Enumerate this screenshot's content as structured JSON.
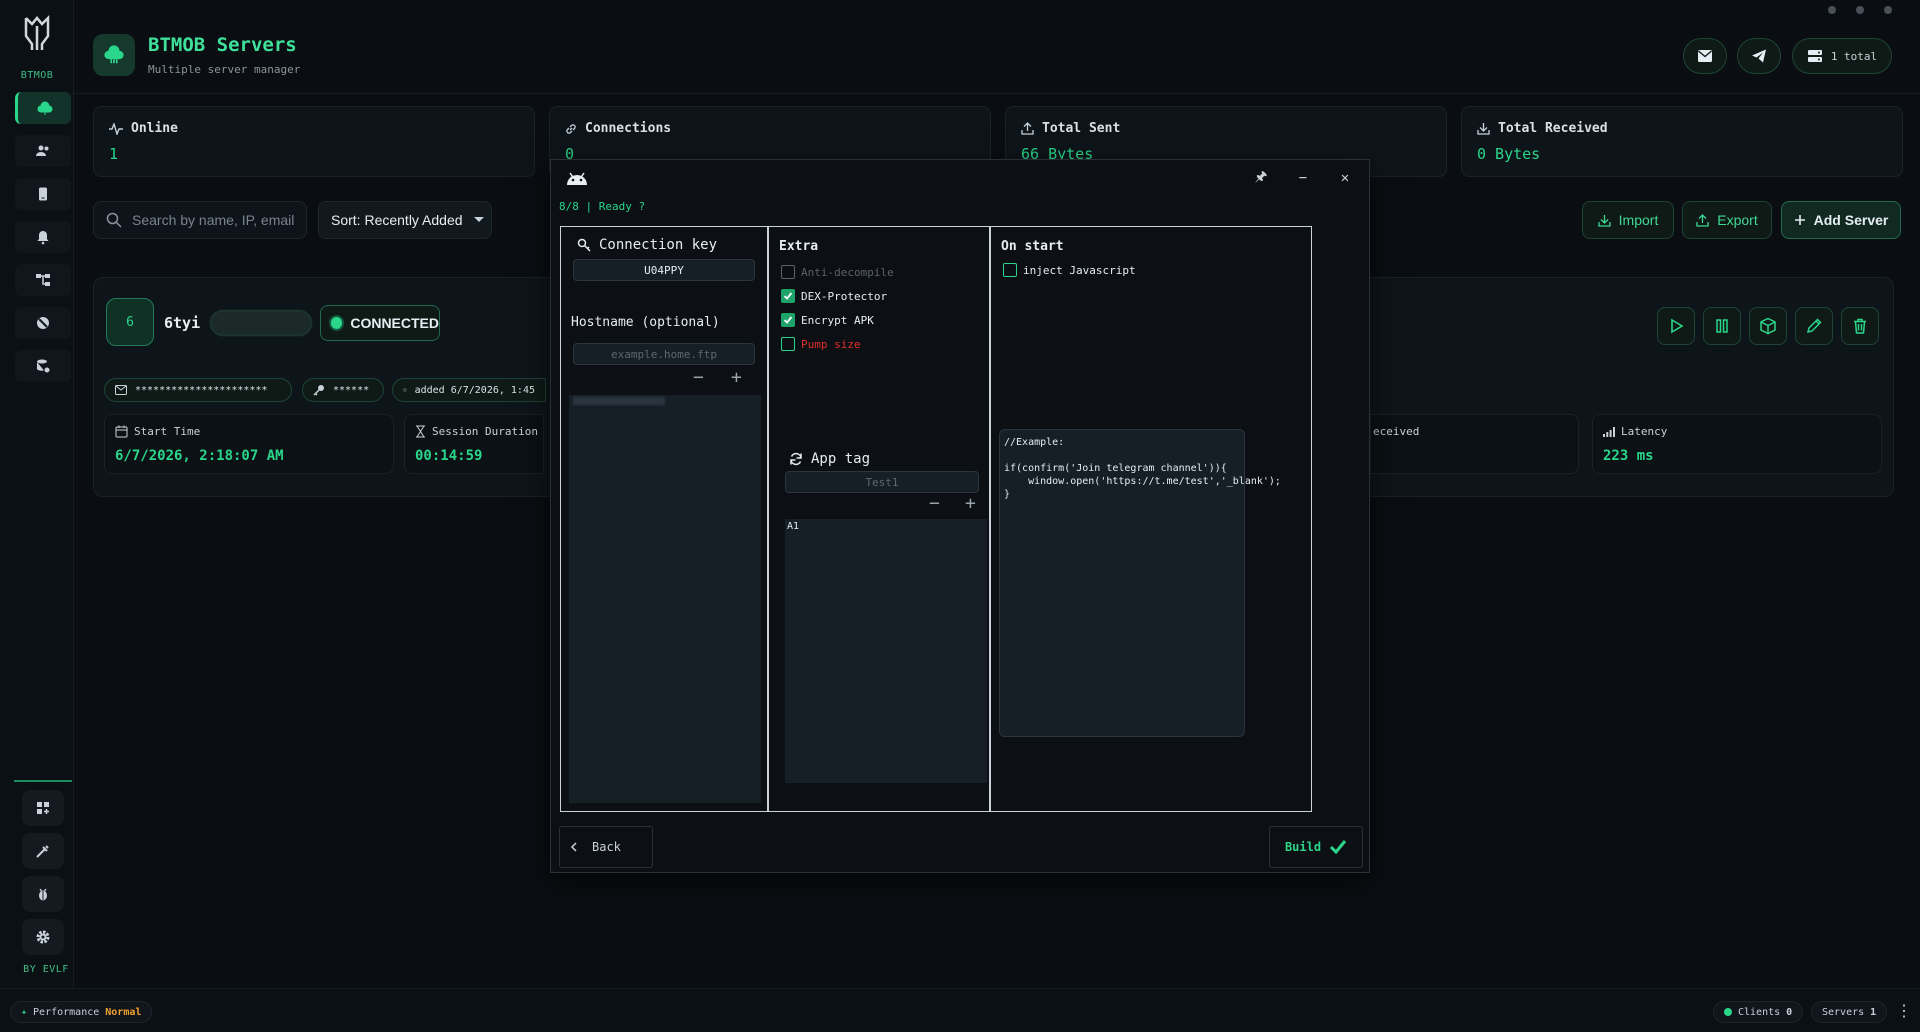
{
  "sidebar": {
    "brand": "BTMOB",
    "footer": "BY EVLF"
  },
  "header": {
    "title": "BTMOB Servers",
    "subtitle": "Multiple server manager",
    "total_label": "1 total"
  },
  "stats": [
    {
      "label": "Online",
      "value": "1"
    },
    {
      "label": "Connections",
      "value": "0"
    },
    {
      "label": "Total Sent",
      "value": "66 Bytes"
    },
    {
      "label": "Total Received",
      "value": "0 Bytes"
    }
  ],
  "toolbar": {
    "search_placeholder": "Search by name, IP, email",
    "sort_label": "Sort: Recently Added",
    "import_label": "Import",
    "export_label": "Export",
    "add_label": "Add Server"
  },
  "server": {
    "number": "6",
    "name": "6tyi",
    "status": "CONNECTED",
    "email": "**********************",
    "password": "******",
    "added": "added 6/7/2026, 1:45",
    "start_time_label": "Start Time",
    "start_time": "6/7/2026, 2:18:07 AM",
    "session_label": "Session Duration",
    "session": "00:14:59",
    "received_label": "eceived",
    "latency_label": "Latency",
    "latency": "223 ms"
  },
  "modal": {
    "status": "8/8 | Ready ?",
    "pin": "🖈",
    "minimize": "−",
    "close": "✕",
    "connection_key_label": "Connection key",
    "connection_key": "U04PPY",
    "hostname_label": "Hostname (optional)",
    "hostname_placeholder": "example.home.ftp",
    "extra_label": "Extra",
    "extra_options": [
      {
        "label": "Anti-decompile",
        "checked": false,
        "disabled": true
      },
      {
        "label": "DEX-Protector",
        "checked": true
      },
      {
        "label": "Encrypt APK",
        "checked": true
      },
      {
        "label": "Pump size",
        "checked": false,
        "color": "#e0302a"
      }
    ],
    "app_tag_label": "App tag",
    "app_tag_placeholder": "Test1",
    "app_tag_item": "A1",
    "on_start_label": "On start",
    "inject_label": "inject Javascript",
    "code": "//Example:\n\nif(confirm('Join telegram channel')){\n    window.open('https://t.me/test','_blank');\n}",
    "back_label": "Back",
    "build_label": "Build"
  },
  "statusbar": {
    "performance_label": "Performance",
    "performance_value": "Normal",
    "clients_label": "Clients",
    "clients_value": "0",
    "servers_label": "Servers",
    "servers_value": "1"
  },
  "colors": {
    "accent": "#2ad68a",
    "warning": "#f0a030",
    "danger": "#e0302a"
  }
}
